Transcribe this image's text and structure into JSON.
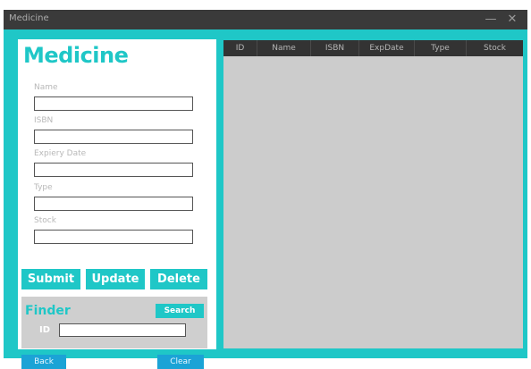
{
  "window": {
    "title": "Medicine",
    "minimize_glyph": "—",
    "close_glyph": "✕"
  },
  "form": {
    "heading": "Medicine",
    "fields": [
      {
        "label": "Name",
        "value": ""
      },
      {
        "label": "ISBN",
        "value": ""
      },
      {
        "label": "Expiery Date",
        "value": ""
      },
      {
        "label": "Type",
        "value": ""
      },
      {
        "label": "Stock",
        "value": ""
      }
    ],
    "buttons": {
      "submit": "Submit",
      "update": "Update",
      "delete": "Delete"
    }
  },
  "finder": {
    "title": "Finder",
    "search_label": "Search",
    "id_label": "ID",
    "id_value": ""
  },
  "footer": {
    "back_label": "Back",
    "clear_label": "Clear"
  },
  "table": {
    "columns": [
      "ID",
      "Name",
      "ISBN",
      "ExpDate",
      "Type",
      "Stock"
    ],
    "rows": []
  },
  "colors": {
    "accent": "#1fc7c7",
    "titlebar": "#3a3a3a",
    "table_header": "#333333",
    "table_body": "#cccccc",
    "nav_button": "#1ba3d6"
  }
}
